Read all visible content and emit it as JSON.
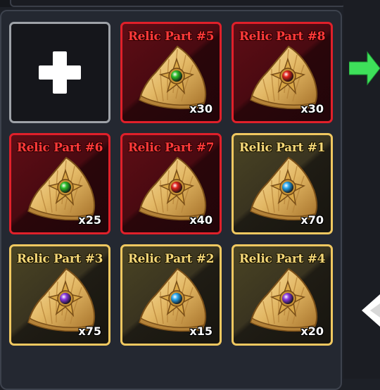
{
  "inventory": {
    "add_slot": {
      "icon": "plus-icon"
    },
    "items": [
      {
        "title": "Relic Part #5",
        "count": "x30",
        "rarity": "red",
        "gem_color": "#2fbf2a"
      },
      {
        "title": "Relic Part #8",
        "count": "x30",
        "rarity": "red",
        "gem_color": "#e0231b"
      },
      {
        "title": "Relic Part #6",
        "count": "x25",
        "rarity": "red",
        "gem_color": "#2fbf2a"
      },
      {
        "title": "Relic Part #7",
        "count": "x40",
        "rarity": "red",
        "gem_color": "#e0231b"
      },
      {
        "title": "Relic Part #1",
        "count": "x70",
        "rarity": "gold",
        "gem_color": "#2aa8ef"
      },
      {
        "title": "Relic Part #3",
        "count": "x75",
        "rarity": "gold",
        "gem_color": "#8b3ae0"
      },
      {
        "title": "Relic Part #2",
        "count": "x15",
        "rarity": "gold",
        "gem_color": "#2aa8ef"
      },
      {
        "title": "Relic Part #4",
        "count": "x20",
        "rarity": "gold",
        "gem_color": "#8b3ae0"
      }
    ]
  },
  "nav": {
    "next_icon": "arrow-right-icon",
    "prev_icon": "arrow-left-icon",
    "next_color": "#3ee05a"
  },
  "colors": {
    "red_border": "#e0202a",
    "gold_border": "#f0c860",
    "panel_bg": "#242831"
  }
}
